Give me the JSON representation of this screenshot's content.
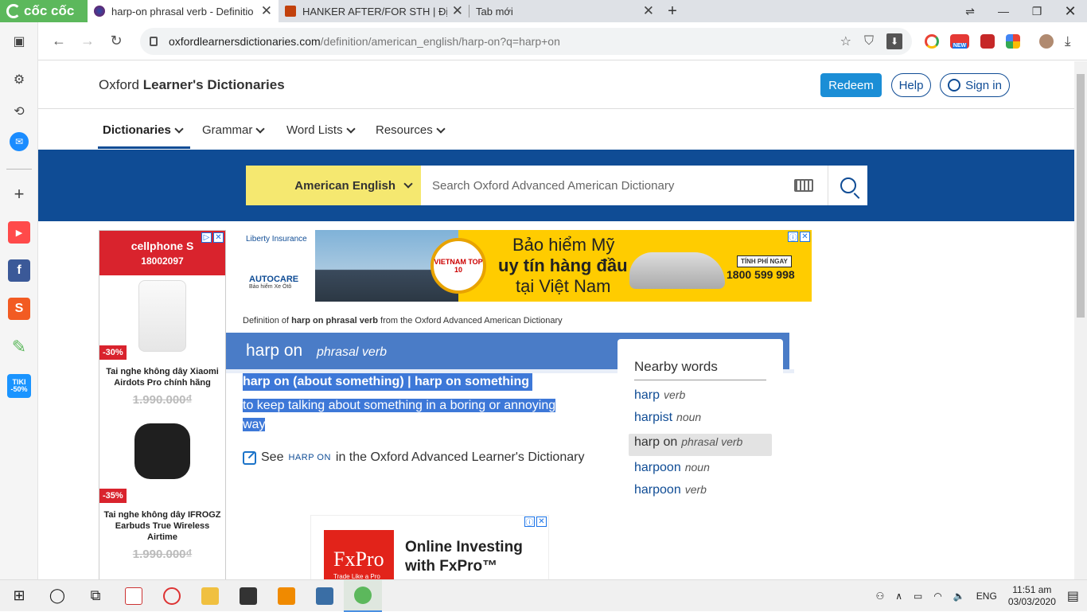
{
  "browser": {
    "brand": "cốc cốc",
    "tabs": [
      {
        "title": "harp-on phrasal verb - Definitio",
        "active": true
      },
      {
        "title": "HANKER AFTER/FOR STH | Định nghĩa",
        "active": false
      },
      {
        "title": "Tab mới",
        "active": false
      }
    ],
    "url_host": "oxfordlearnersdictionaries.com",
    "url_path": "/definition/american_english/harp-on?q=harp+on",
    "ext_new_badge": "NEW"
  },
  "header": {
    "site_name_plain": "Oxford ",
    "site_name_bold": "Learner's Dictionaries",
    "redeem": "Redeem",
    "help": "Help",
    "sign_in": "Sign in"
  },
  "nav": {
    "items": [
      "Dictionaries",
      "Grammar",
      "Word Lists",
      "Resources"
    ]
  },
  "search": {
    "dictionary": "American English",
    "placeholder": "Search Oxford Advanced American Dictionary"
  },
  "ads": {
    "cellphone": {
      "brand": "cellphone S",
      "phone": "18002097",
      "products": [
        {
          "discount": "-30%",
          "name": "Tai nghe không dây Xiaomi Airdots Pro chính hãng",
          "price": "1.990.000₫"
        },
        {
          "discount": "-35%",
          "name": "Tai nghe không dây IFROGZ Earbuds True Wireless Airtime",
          "price": "1.990.000₫"
        }
      ]
    },
    "liberty": {
      "brand": "Liberty Insurance",
      "autocare": "AUTOCARE",
      "autocare_sub": "Bảo hiểm Xe Ôtô",
      "line1": "Bảo hiểm Mỹ",
      "line2": "uy tín hàng đầu",
      "line3": "tại Việt Nam",
      "medal": "VIETNAM TOP 10",
      "cta": "TÍNH PHÍ NGAY",
      "hotline": "1800 599 998"
    },
    "fxpro": {
      "logo": "FxPro",
      "logo_tagline": "Trade Like a Pro",
      "text1": "Online Investing",
      "text2": "with FxPro™"
    }
  },
  "entry": {
    "breadcrumb_pre": "Definition of ",
    "breadcrumb_bold": "harp on phrasal verb",
    "breadcrumb_post": " from the Oxford Advanced American Dictionary",
    "headword": "harp on",
    "pos": "phrasal verb",
    "idiom": "harp on (about something) | harp on something",
    "definition": "to keep talking about something in a boring or annoying way",
    "see_pre": "See ",
    "see_link": "HARP ON",
    "see_post": " in the Oxford Advanced Learner's Dictionary"
  },
  "nearby": {
    "title": "Nearby words",
    "items": [
      {
        "word": "harp",
        "pos": "verb"
      },
      {
        "word": "harpist",
        "pos": "noun"
      },
      {
        "word": "harp on",
        "pos": "phrasal verb"
      },
      {
        "word": "harpoon",
        "pos": "noun"
      },
      {
        "word": "harpoon",
        "pos": "verb"
      }
    ]
  },
  "taskbar": {
    "language": "ENG",
    "time": "11:51 am",
    "date": "03/03/2020"
  },
  "colors": {
    "oxford_blue": "#0f4c95",
    "entry_blue": "#4a7cc7",
    "selection": "#3d78d8",
    "dict_yellow": "#f5e870",
    "coccoc_green": "#5cb85c"
  }
}
